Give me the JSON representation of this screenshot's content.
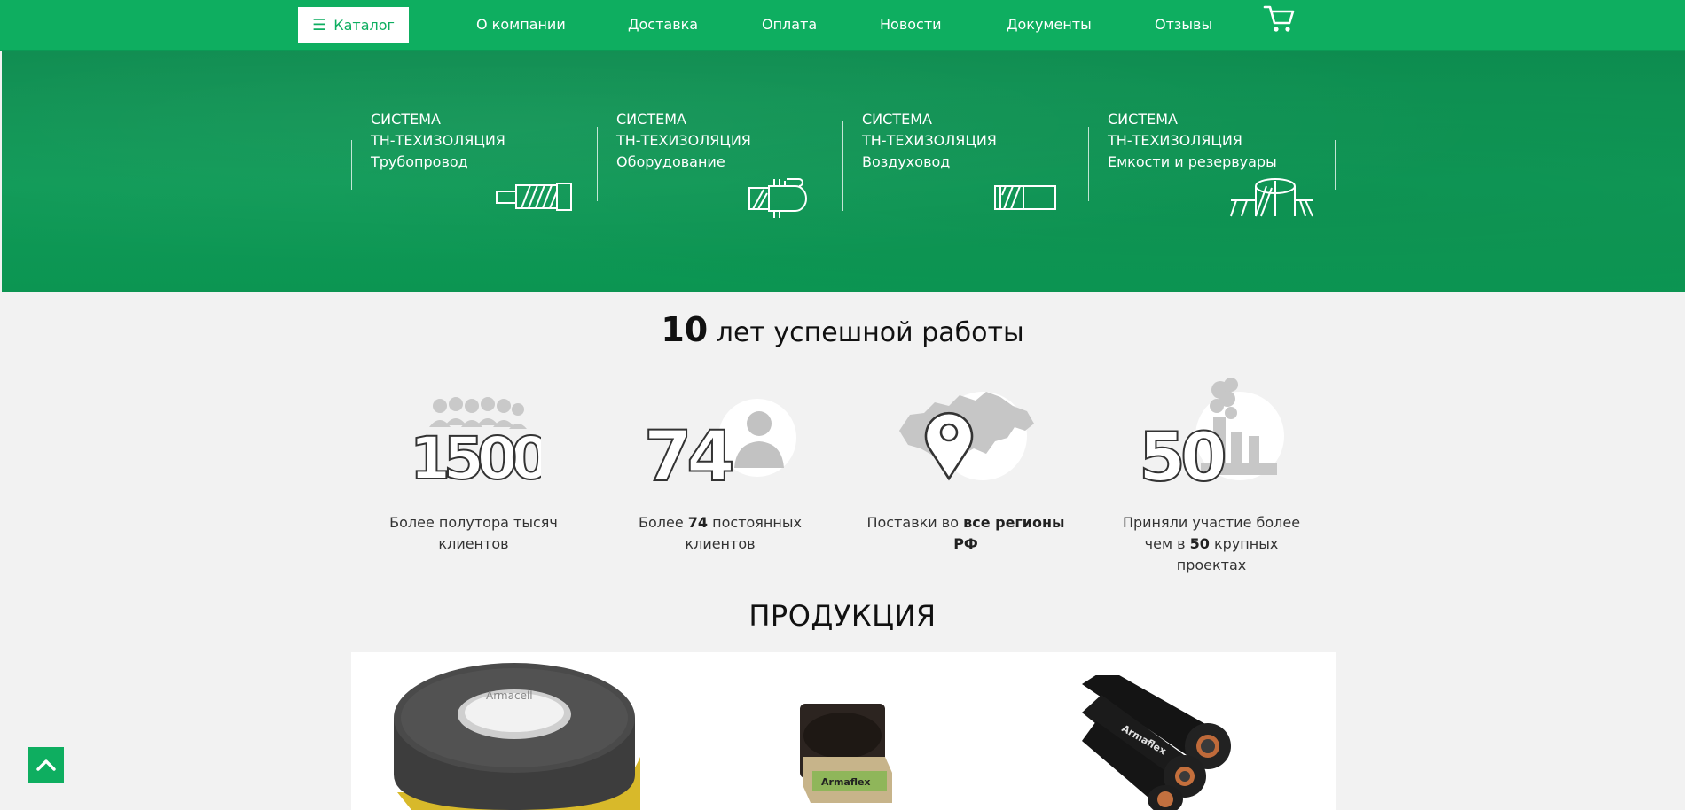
{
  "header": {
    "catalog_label": "Каталог",
    "nav": [
      "О компании",
      "Доставка",
      "Оплата",
      "Новости",
      "Документы",
      "Отзывы"
    ],
    "cart_icon": "cart-icon",
    "brand_color": "#0eae60"
  },
  "systems": [
    {
      "line1": "СИСТЕМА",
      "line2": "ТН-ТЕХИЗОЛЯЦИЯ",
      "line3": "Трубопровод",
      "icon": "pipe-icon"
    },
    {
      "line1": "СИСТЕМА",
      "line2": "ТН-ТЕХИЗОЛЯЦИЯ",
      "line3": "Оборудование",
      "icon": "equipment-icon"
    },
    {
      "line1": "СИСТЕМА",
      "line2": "ТН-ТЕХИЗОЛЯЦИЯ",
      "line3": "Воздуховод",
      "icon": "duct-icon"
    },
    {
      "line1": "СИСТЕМА",
      "line2": "ТН-ТЕХИЗОЛЯЦИЯ",
      "line3": "Емкости и резервуары",
      "icon": "tank-icon"
    }
  ],
  "stats": {
    "title_number": "10",
    "title_text": "лет успешной работы",
    "items": [
      {
        "graphic": "1500",
        "pre": "Более полутора тысяч клиентов",
        "bold": "",
        "post": ""
      },
      {
        "graphic": "74",
        "pre": "Более ",
        "bold": "74",
        "post": " постоянных клиентов"
      },
      {
        "graphic": "map-pin",
        "pre": "Поставки во ",
        "bold": "все регионы РФ",
        "post": ""
      },
      {
        "graphic": "50",
        "pre": "Приняли участие более чем в ",
        "bold": "50",
        "post": " крупных проектах"
      }
    ]
  },
  "products": {
    "title": "ПРОДУКЦИЯ",
    "items": [
      {
        "name": "armaflex-tape-roll",
        "brand_text": "Armacell"
      },
      {
        "name": "armaflex-sheet-box",
        "brand_text": "Armaflex"
      },
      {
        "name": "armaflex-tubes",
        "brand_text": "Armaflex"
      }
    ]
  },
  "scroll_top_icon": "chevron-up-icon"
}
